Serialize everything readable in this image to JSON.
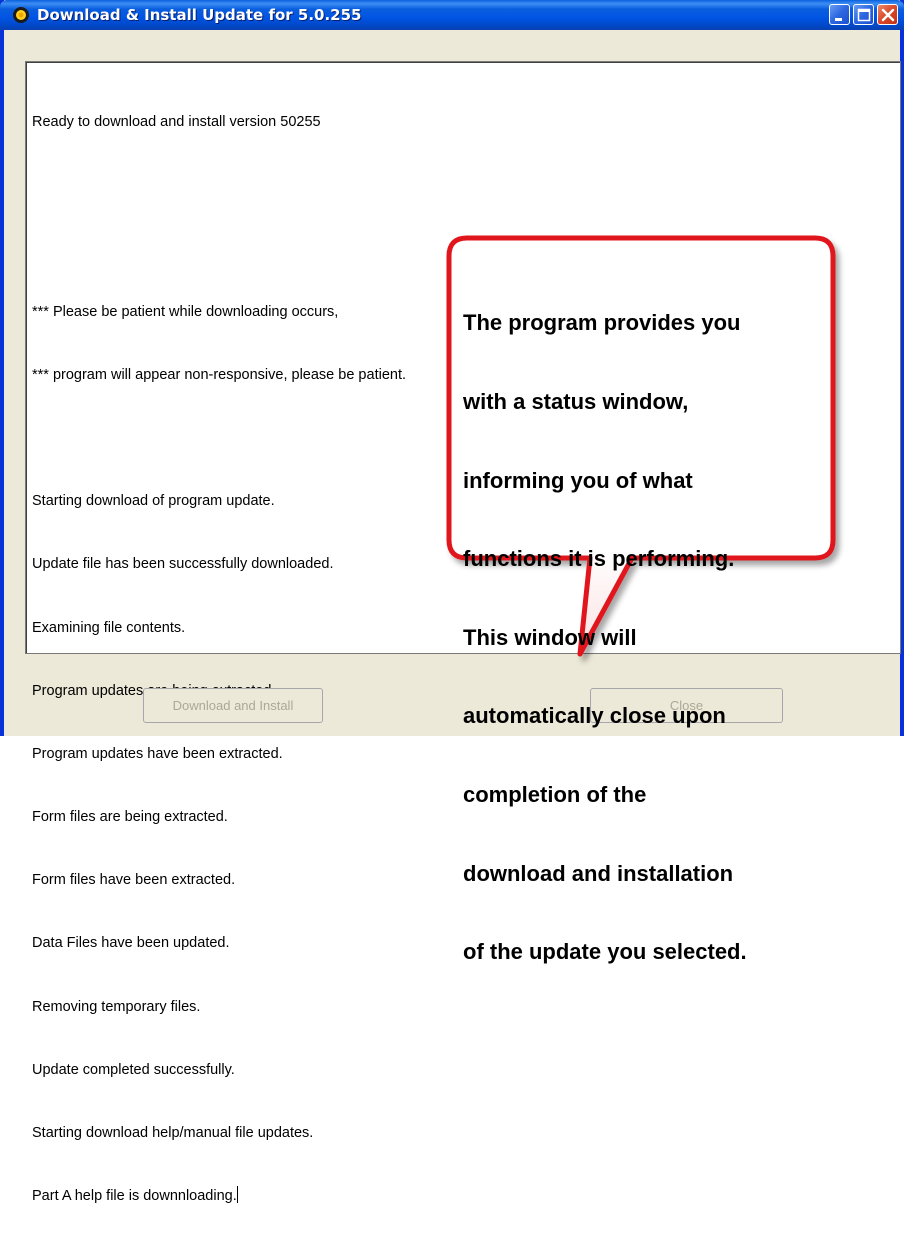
{
  "window": {
    "title": "Download & Install Update for 5.0.255",
    "icon": "sun-icon"
  },
  "log": {
    "lines": [
      "Ready to download and install version 50255",
      "",
      "",
      "*** Please be patient while downloading occurs,",
      "*** program will appear non-responsive, please be patient.",
      "",
      "Starting download of program update.",
      "Update file has been successfully downloaded.",
      "Examining file contents.",
      "Program updates are being extracted.",
      "Program updates have been extracted.",
      "Form files are being extracted.",
      "Form files have been extracted.",
      "Data Files have been updated.",
      "Removing temporary files.",
      "Update completed successfully.",
      "Starting download help/manual file updates.",
      "Part A help file is downnloading."
    ]
  },
  "buttons": {
    "download_install": "Download and Install",
    "close": "Close"
  },
  "callout": {
    "lines": [
      "The program provides you",
      "with a status window,",
      "informing you of what",
      "functions it is performing.",
      "This window will",
      "automatically close upon",
      "completion of the",
      "download and installation",
      "of the update you selected."
    ]
  },
  "colors": {
    "titlebar": "#0054e3",
    "callout_border": "#e0141e",
    "window_bg": "#ece9d8"
  }
}
